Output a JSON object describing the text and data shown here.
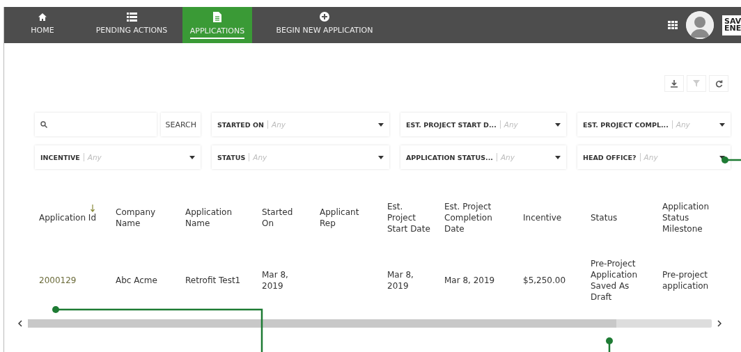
{
  "nav": {
    "items": [
      {
        "label": "HOME",
        "selected": false
      },
      {
        "label": "PENDING ACTIONS",
        "selected": false
      },
      {
        "label": "APPLICATIONS",
        "selected": true
      },
      {
        "label": "BEGIN NEW APPLICATION",
        "selected": false
      }
    ],
    "logo": [
      "SAV",
      "ENE"
    ]
  },
  "toolbar": [
    {
      "disabled": false
    },
    {
      "disabled": true
    },
    {
      "disabled": false
    }
  ],
  "search": {
    "button": "SEARCH"
  },
  "filters": [
    {
      "label": "STARTED ON",
      "placeholder": "Any"
    },
    {
      "label": "EST. PROJECT START D...",
      "placeholder": "Any"
    },
    {
      "label": "EST. PROJECT COMPL...",
      "placeholder": "Any"
    },
    {
      "label": "INCENTIVE",
      "placeholder": "Any"
    },
    {
      "label": "STATUS",
      "placeholder": "Any"
    },
    {
      "label": "APPLICATION STATUS...",
      "placeholder": "Any"
    },
    {
      "label": "HEAD OFFICE?",
      "placeholder": "Any"
    }
  ],
  "table": {
    "columns": [
      {
        "label": "Application Id",
        "sorted": true
      },
      {
        "label": "Company Name",
        "sorted": false
      },
      {
        "label": "Application Name",
        "sorted": false
      },
      {
        "label": "Started On",
        "sorted": false
      },
      {
        "label": "Applicant Rep",
        "sorted": false
      },
      {
        "label": "Est. Project Start Date",
        "sorted": false
      },
      {
        "label": "Est. Project Completion Date",
        "sorted": false
      },
      {
        "label": "Incentive",
        "sorted": false
      },
      {
        "label": "Status",
        "sorted": false
      },
      {
        "label": "Application Status Milestone",
        "sorted": false
      }
    ],
    "rows": [
      {
        "cells": [
          {
            "kind": "link",
            "text": "2000129"
          },
          {
            "kind": "text",
            "text": "Abc Acme"
          },
          {
            "kind": "text",
            "text": "Retrofit Test1"
          },
          {
            "kind": "text",
            "text": "Mar 8, 2019"
          },
          {
            "kind": "empty"
          },
          {
            "kind": "text",
            "text": "Mar 8, 2019"
          },
          {
            "kind": "text",
            "text": "Mar 8, 2019"
          },
          {
            "kind": "text",
            "text": "$5,250.00"
          },
          {
            "kind": "text",
            "text": "Pre-Project Application Saved As Draft"
          },
          {
            "kind": "text",
            "text": "Pre-project application"
          }
        ]
      }
    ]
  }
}
